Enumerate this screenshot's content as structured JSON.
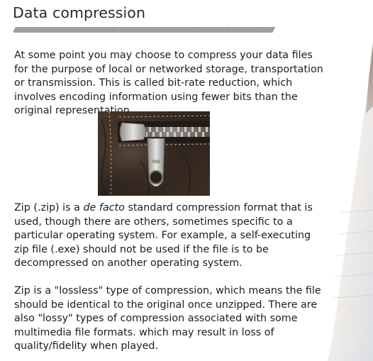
{
  "document": {
    "title": "Data compression",
    "divider": "////////////////////////////////////////////////////////////////////////////////////////////////////////////////////////////////////////////////////////////////////////////////////////////////////",
    "paragraph1": "At some point you may choose to compress your data files for the purpose of local or networked storage, transportation or transmission. This is called bit-rate reduction, which involves encoding information using fewer bits than the original representation.",
    "paragraph2": {
      "before": "Zip (.zip) is a ",
      "italic": "de facto",
      "after": " standard compression format that is used, though there are others, sometimes specific to a particular operating system. For example, a self-executing zip file (.exe) should not be used if the file is to be decompressed on another operating system."
    },
    "paragraph3": "Zip is a \"lossless\" type of compression, which means the file should be identical to the original once unzipped. There are also \"lossy\" types of compression associated with some multimedia file formats.  which may result in loss of quality/fidelity when played.",
    "image": {
      "subject": "zipper-photo",
      "pull_label": "YKK"
    }
  },
  "colors": {
    "text": "#1d1d1d",
    "leather": "#3a2c22",
    "metal": "#b8b8b4"
  }
}
